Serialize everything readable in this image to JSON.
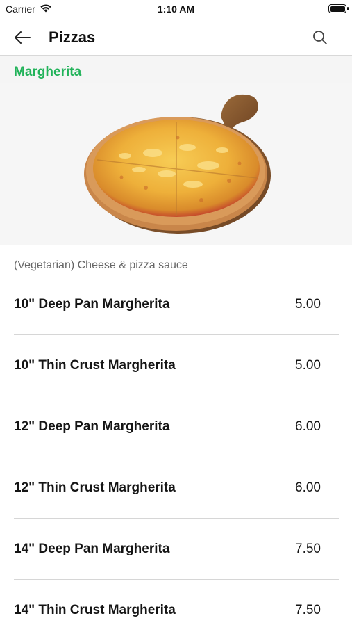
{
  "status_bar": {
    "carrier": "Carrier",
    "time": "1:10 AM"
  },
  "nav": {
    "title": "Pizzas",
    "back_icon": "arrow-left-icon",
    "search_icon": "search-icon"
  },
  "section": {
    "title": "Margherita"
  },
  "hero": {
    "image": "margherita-pizza-on-wooden-board"
  },
  "description": "(Vegetarian) Cheese & pizza sauce",
  "items": [
    {
      "name": "10\" Deep Pan Margherita",
      "price": "5.00"
    },
    {
      "name": "10\" Thin Crust Margherita",
      "price": "5.00"
    },
    {
      "name": "12\" Deep Pan Margherita",
      "price": "6.00"
    },
    {
      "name": "12\" Thin Crust Margherita",
      "price": "6.00"
    },
    {
      "name": "14\" Deep Pan Margherita",
      "price": "7.50"
    },
    {
      "name": "14\" Thin Crust Margherita",
      "price": "7.50"
    }
  ],
  "colors": {
    "accent": "#22b35a"
  }
}
